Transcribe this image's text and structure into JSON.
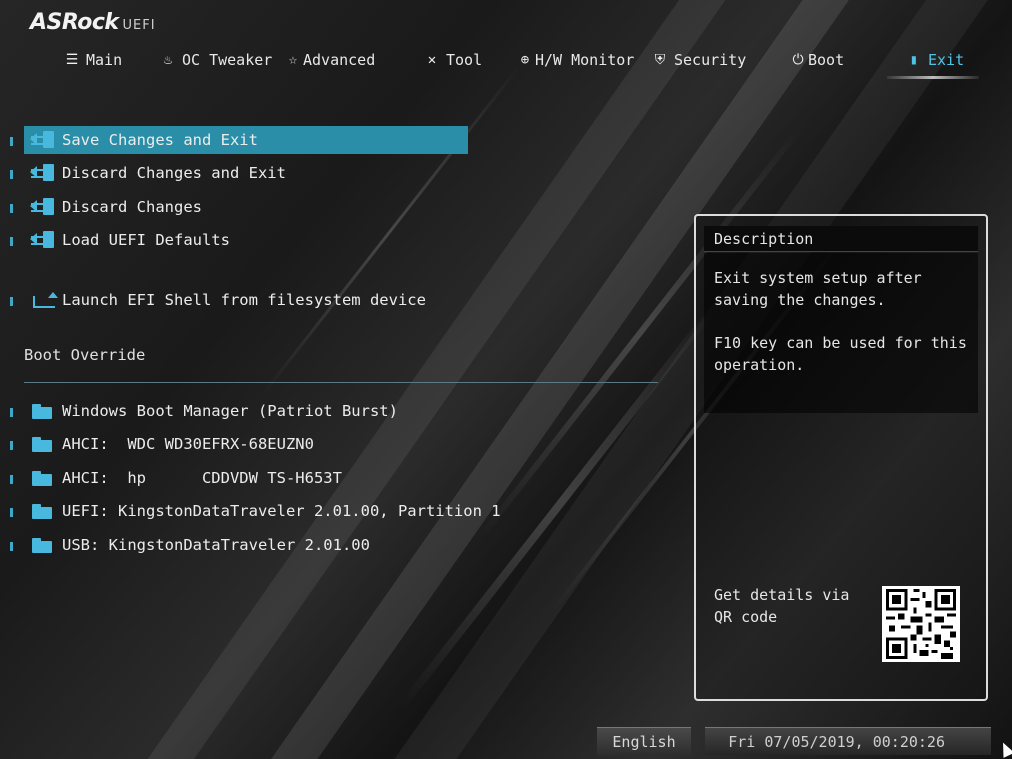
{
  "brand": {
    "logo": "ASRock",
    "suffix": "UEFI"
  },
  "tabs": [
    {
      "label": "Main",
      "icon": "list-icon"
    },
    {
      "label": "OC Tweaker",
      "icon": "flame-icon"
    },
    {
      "label": "Advanced",
      "icon": "star-icon"
    },
    {
      "label": "Tool",
      "icon": "tools-icon"
    },
    {
      "label": "H/W Monitor",
      "icon": "crosshair-icon"
    },
    {
      "label": "Security",
      "icon": "shield-icon"
    },
    {
      "label": "Boot",
      "icon": "power-icon"
    },
    {
      "label": "Exit",
      "icon": "exit-door-icon"
    }
  ],
  "active_tab": "Exit",
  "menu": {
    "exit_items": [
      {
        "label": "Save Changes and Exit",
        "icon": "exit-arrow-icon",
        "selected": true
      },
      {
        "label": "Discard Changes and Exit",
        "icon": "exit-arrow-icon"
      },
      {
        "label": "Discard Changes",
        "icon": "exit-arrow-icon"
      },
      {
        "label": "Load UEFI Defaults",
        "icon": "exit-arrow-icon"
      }
    ],
    "shell_item": {
      "label": "Launch EFI Shell from filesystem device",
      "icon": "shell-arrow-icon"
    },
    "boot_override_title": "Boot Override",
    "boot_items": [
      {
        "label": "Windows Boot Manager (Patriot Burst)",
        "icon": "folder-icon"
      },
      {
        "label": "AHCI:  WDC WD30EFRX-68EUZN0",
        "icon": "folder-icon"
      },
      {
        "label": "AHCI:  hp      CDDVDW TS-H653T",
        "icon": "folder-icon"
      },
      {
        "label": "UEFI: KingstonDataTraveler 2.01.00, Partition 1",
        "icon": "folder-icon"
      },
      {
        "label": "USB: KingstonDataTraveler 2.01.00",
        "icon": "folder-icon"
      }
    ]
  },
  "description": {
    "title": "Description",
    "line1": "Exit system setup after saving the changes.",
    "line2": "F10 key can be used for this operation.",
    "qr_label": "Get details via QR code"
  },
  "footer": {
    "language": "English",
    "datetime": "Fri 07/05/2019, 00:20:26"
  },
  "colors": {
    "accent": "#4ec3e6",
    "selected_row": "#2b8ea8",
    "icon": "#49b8de"
  }
}
